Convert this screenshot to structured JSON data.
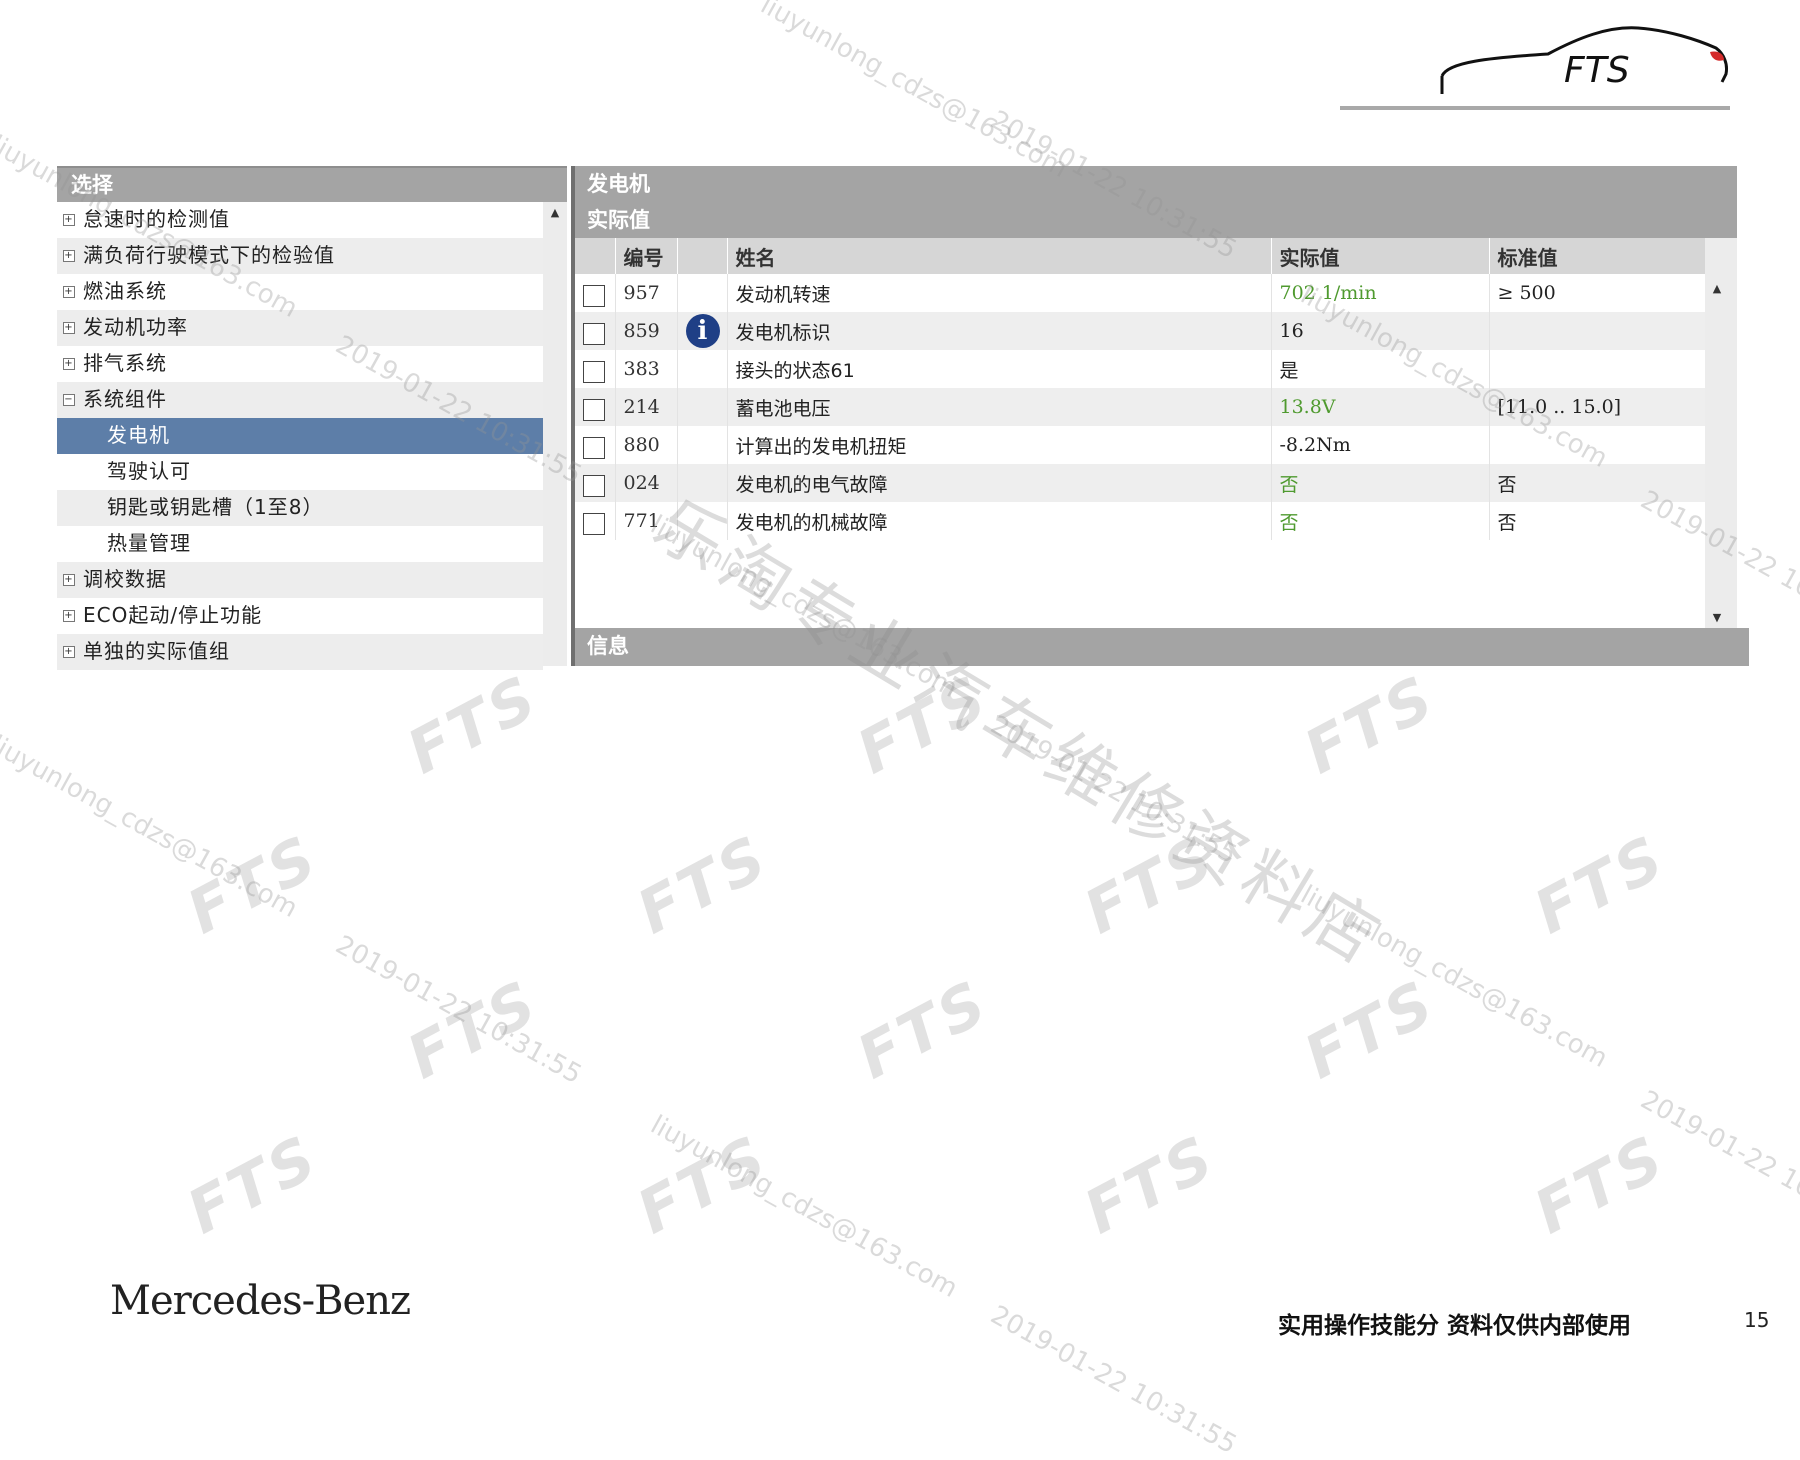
{
  "logo": {
    "text": "FTS"
  },
  "left_panel": {
    "header": "选择",
    "tree": [
      {
        "label": "怠速时的检测值",
        "expander": "+"
      },
      {
        "label": "满负荷行驶模式下的检验值",
        "expander": "+"
      },
      {
        "label": "燃油系统",
        "expander": "+"
      },
      {
        "label": "发动机功率",
        "expander": "+"
      },
      {
        "label": "排气系统",
        "expander": "+"
      },
      {
        "label": "系统组件",
        "expander": "−"
      },
      {
        "label": "发电机"
      },
      {
        "label": "驾驶认可"
      },
      {
        "label": "钥匙或钥匙槽（1至8）"
      },
      {
        "label": "热量管理"
      },
      {
        "label": "调校数据",
        "expander": "+"
      },
      {
        "label": "ECO起动/停止功能",
        "expander": "+"
      },
      {
        "label": "单独的实际值组",
        "expander": "+"
      }
    ]
  },
  "right_panel": {
    "title": "发电机",
    "section": "实际值",
    "columns": {
      "number": "编号",
      "name": "姓名",
      "actual": "实际值",
      "standard": "标准值"
    },
    "rows": [
      {
        "number": "957",
        "name": "发动机转速",
        "actual": "702 1/min",
        "standard": "≥ 500"
      },
      {
        "number": "859",
        "name": "发电机标识",
        "actual": "16",
        "standard": ""
      },
      {
        "number": "383",
        "name": "接头的状态61",
        "actual": "是",
        "standard": ""
      },
      {
        "number": "214",
        "name": "蓄电池电压",
        "actual": "13.8V",
        "standard": "[11.0 .. 15.0]"
      },
      {
        "number": "880",
        "name": "计算出的发电机扭矩",
        "actual": "-8.2Nm",
        "standard": ""
      },
      {
        "number": "024",
        "name": "发电机的电气故障",
        "actual": "否",
        "standard": "否"
      },
      {
        "number": "771",
        "name": "发电机的机械故障",
        "actual": "否",
        "standard": "否"
      }
    ],
    "info_glyph": "i",
    "footer": "信息"
  },
  "scroll": {
    "up": "▲",
    "down": "▼"
  },
  "footer": {
    "brand": "Mercedes-Benz",
    "note": "实用操作技能分 资料仅供内部使用",
    "page_number": "15"
  },
  "watermark": {
    "mark": "FTS",
    "email": "liuyunlong_cdzs@163.com",
    "timestamp": "2019-01-22 10:31:55",
    "shop": "乐淘专业汽车维修资料店"
  },
  "colors": {
    "header_gray": "#a4a4a4",
    "selected_blue": "#5d7ea8",
    "value_green": "#4f9a2f",
    "info_blue": "#1f3f86"
  },
  "icons": [
    "info-icon",
    "expander-plus-icon",
    "expander-minus-icon",
    "checkbox-icon",
    "scroll-up-icon",
    "scroll-down-icon"
  ]
}
